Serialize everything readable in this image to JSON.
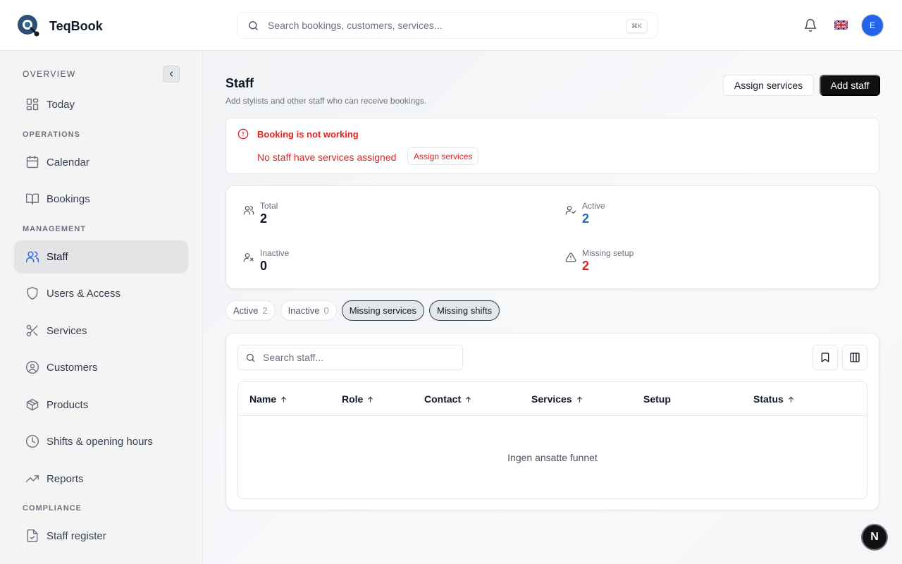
{
  "app": {
    "name": "TeqBook"
  },
  "search": {
    "placeholder": "Search bookings, customers, services...",
    "shortcut": "⌘K"
  },
  "header": {
    "avatar_initial": "E",
    "language_flag": "uk-flag-icon"
  },
  "sidebar": {
    "sections": {
      "overview": "OVERVIEW",
      "operations": "OPERATIONS",
      "management": "MANAGEMENT",
      "compliance": "COMPLIANCE"
    },
    "items": [
      {
        "label": "Today",
        "icon": "dashboard-icon"
      },
      {
        "label": "Calendar",
        "icon": "calendar-icon"
      },
      {
        "label": "Bookings",
        "icon": "book-icon"
      },
      {
        "label": "Staff",
        "icon": "users-icon",
        "active": true
      },
      {
        "label": "Users & Access",
        "icon": "shield-icon"
      },
      {
        "label": "Services",
        "icon": "scissors-icon"
      },
      {
        "label": "Customers",
        "icon": "user-circle-icon"
      },
      {
        "label": "Products",
        "icon": "package-icon"
      },
      {
        "label": "Shifts & opening hours",
        "icon": "clock-icon"
      },
      {
        "label": "Reports",
        "icon": "trending-up-icon"
      },
      {
        "label": "Staff register",
        "icon": "file-check-icon"
      }
    ]
  },
  "page": {
    "title": "Staff",
    "subtitle": "Add stylists and other staff who can receive bookings.",
    "assign_services_label": "Assign services",
    "add_staff_label": "Add staff"
  },
  "alert": {
    "title": "Booking is not working",
    "message": "No staff have services assigned",
    "action_label": "Assign services"
  },
  "stats": {
    "total": {
      "label": "Total",
      "value": "2"
    },
    "active": {
      "label": "Active",
      "value": "2",
      "color": "#2b6cb0"
    },
    "inactive": {
      "label": "Inactive",
      "value": "0"
    },
    "missing_setup": {
      "label": "Missing setup",
      "value": "2",
      "color": "#dc2626"
    }
  },
  "filters": [
    {
      "label": "Active",
      "count": "2",
      "selected": false
    },
    {
      "label": "Inactive",
      "count": "0",
      "selected": false
    },
    {
      "label": "Missing services",
      "count": "",
      "selected": true
    },
    {
      "label": "Missing shifts",
      "count": "",
      "selected": true
    }
  ],
  "table": {
    "search_placeholder": "Search staff...",
    "columns": [
      {
        "label": "Name",
        "sortable": true
      },
      {
        "label": "Role",
        "sortable": true
      },
      {
        "label": "Contact",
        "sortable": true
      },
      {
        "label": "Services",
        "sortable": true
      },
      {
        "label": "Setup",
        "sortable": false
      },
      {
        "label": "Status",
        "sortable": true
      }
    ],
    "empty_message": "Ingen ansatte funnet"
  },
  "dev_badge": {
    "label": "N"
  }
}
